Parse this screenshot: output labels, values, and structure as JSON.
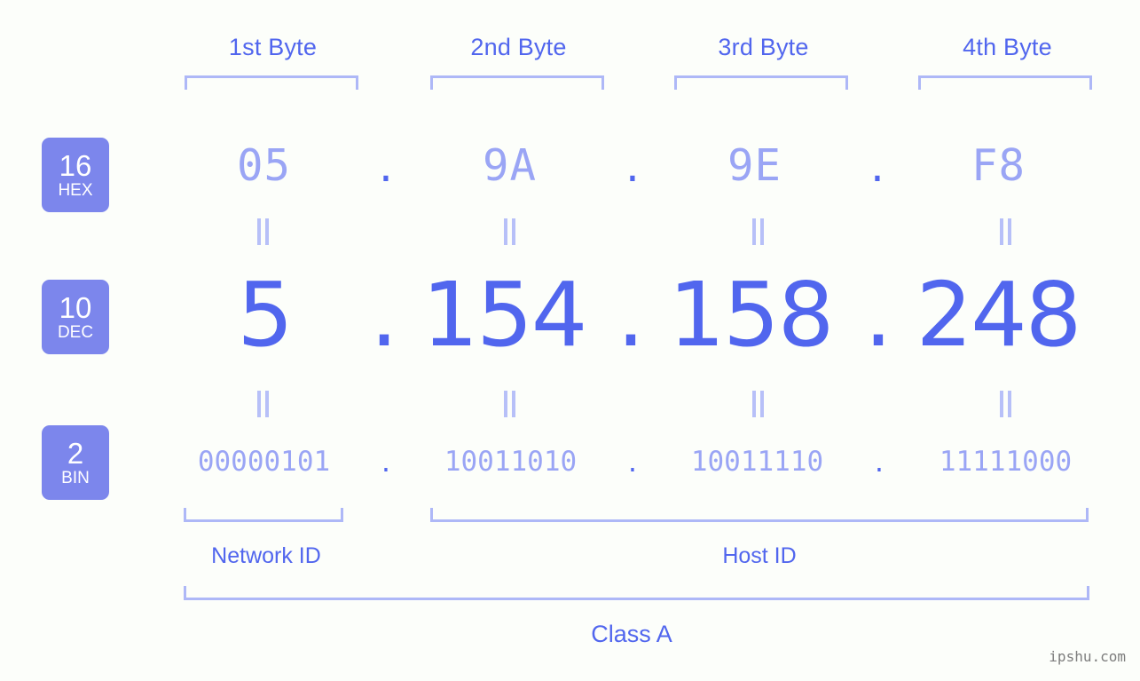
{
  "page": {
    "background_color": "#fcfefa",
    "accent_color": "#5166ee",
    "accent_light_color": "#9aa5f5",
    "bracket_color": "#aeb8f7",
    "badge_color": "#7c86ec"
  },
  "byte_headers": [
    {
      "label": "1st Byte"
    },
    {
      "label": "2nd Byte"
    },
    {
      "label": "3rd Byte"
    },
    {
      "label": "4th Byte"
    }
  ],
  "rows": [
    {
      "badge": {
        "base": "16",
        "name": "HEX"
      },
      "values": [
        "05",
        "9A",
        "9E",
        "F8"
      ],
      "separator": "."
    },
    {
      "badge": {
        "base": "10",
        "name": "DEC"
      },
      "values": [
        "5",
        "154",
        "158",
        "248"
      ],
      "separator": "."
    },
    {
      "badge": {
        "base": "2",
        "name": "BIN"
      },
      "values": [
        "00000101",
        "10011010",
        "10011110",
        "11111000"
      ],
      "separator": "."
    }
  ],
  "equality_symbol": "||",
  "segments": {
    "network_id": "Network ID",
    "host_id": "Host ID"
  },
  "class_label": "Class A",
  "watermark": "ipshu.com"
}
